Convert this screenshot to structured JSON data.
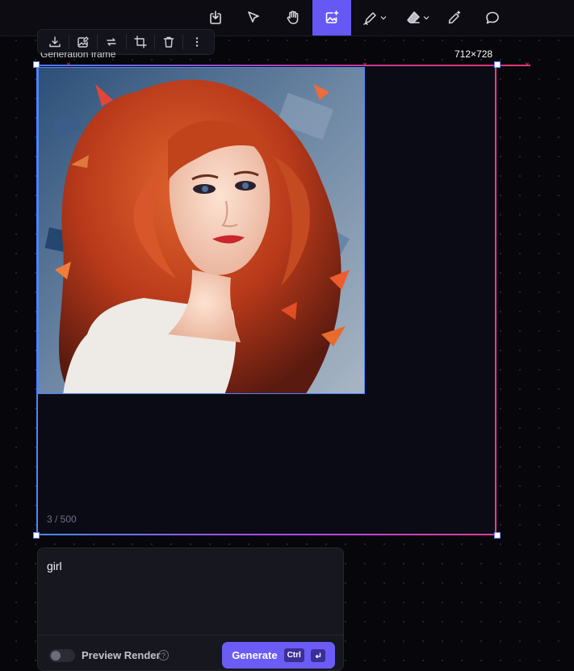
{
  "toolbar": {
    "tools": [
      {
        "name": "import-tool-button"
      },
      {
        "name": "select-tool-button"
      },
      {
        "name": "hand-tool-button"
      },
      {
        "name": "generate-image-tool-button",
        "active": true
      },
      {
        "name": "pen-tool-button"
      },
      {
        "name": "eraser-tool-button"
      },
      {
        "name": "magic-wand-tool-button"
      },
      {
        "name": "comment-tool-button"
      }
    ],
    "accent_color": "#6558f5"
  },
  "image_actions": [
    "download",
    "upscale",
    "replace",
    "crop",
    "delete",
    "more"
  ],
  "frame": {
    "label": "Generation frame",
    "dimensions": "712×728",
    "counter": "3 / 500"
  },
  "prompt": {
    "value": "girl",
    "preview_render_label": "Preview Render",
    "preview_render_enabled": false,
    "help_icon": "?",
    "generate_label": "Generate",
    "shortcut_key": "Ctrl",
    "enter_icon": "↵"
  }
}
